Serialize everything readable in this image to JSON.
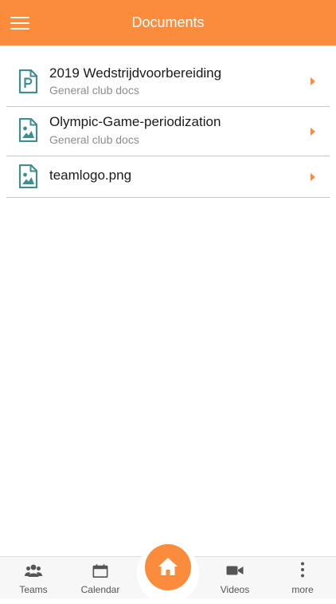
{
  "header": {
    "title": "Documents",
    "accent_color": "#FB8C3C",
    "menu_icon": "hamburger-menu-icon"
  },
  "documents": [
    {
      "title": "2019 Wedstrijdvoorbereiding",
      "subtitle": "General club docs",
      "icon": "pdf-file-icon"
    },
    {
      "title": "Olympic-Game-periodization",
      "subtitle": "General club docs",
      "icon": "image-file-icon"
    },
    {
      "title": "teamlogo.png",
      "subtitle": "",
      "icon": "image-file-icon"
    }
  ],
  "icon_color": "#3E8E8E",
  "tabs": [
    {
      "label": "Teams",
      "icon": "teams-icon"
    },
    {
      "label": "Calendar",
      "icon": "calendar-icon"
    },
    {
      "label": "",
      "icon": "home-icon"
    },
    {
      "label": "Videos",
      "icon": "video-camera-icon"
    },
    {
      "label": "more",
      "icon": "more-vertical-icon"
    }
  ]
}
